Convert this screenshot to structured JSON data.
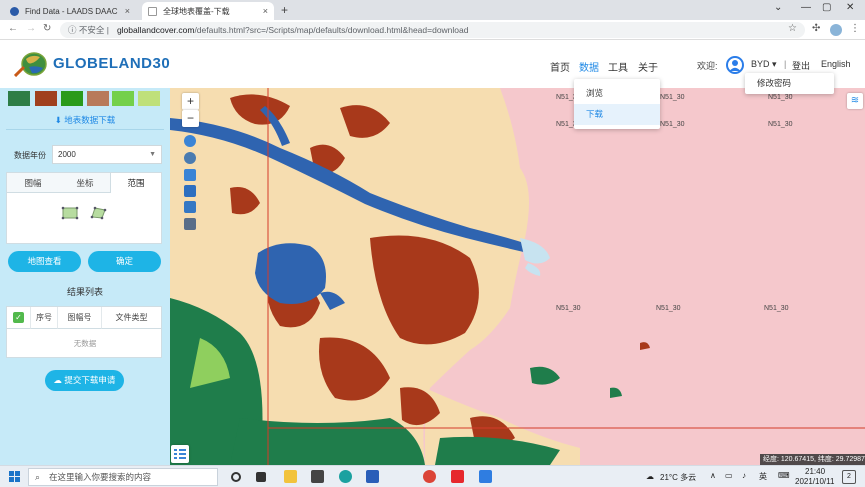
{
  "browser": {
    "tabs": [
      {
        "label": "Find Data - LAADS DAAC",
        "close": "×",
        "active": false
      },
      {
        "label": "全球地表覆盖-下载",
        "close": "×",
        "active": true
      }
    ],
    "new_tab": "+",
    "window_controls": [
      "⌄",
      "—",
      "▢",
      "✕"
    ],
    "insecure_label": "ⓘ 不安全 |",
    "url_host": "globallandcover.com",
    "url_path": "/defaults.html?src=/Scripts/map/defaults/download.html&head=download"
  },
  "header": {
    "logo": "GLOBELAND30",
    "nav": [
      "首页",
      "数据",
      "工具",
      "关于"
    ],
    "active_nav": "数据",
    "welcome": "欢迎:",
    "user": "BYD ▾",
    "divider": "|",
    "logout": "登出",
    "language": "English",
    "user_menu": [
      "修改密码"
    ],
    "data_menu": [
      {
        "label": "浏览",
        "selected": false
      },
      {
        "label": "下载",
        "selected": true
      }
    ]
  },
  "sidebar": {
    "swatch_colors": [
      "#2e7d46",
      "#a0401e",
      "#2a9a1a",
      "#b87a5a",
      "#74d04a",
      "#bfe07a"
    ],
    "download_title": "⬇ 地表数据下载",
    "year_label": "数据年份",
    "year_value": "2000",
    "subtabs": [
      "图幅",
      "坐标",
      "范围"
    ],
    "active_subtab": "范围",
    "btn_map_view": "地图查看",
    "btn_confirm": "确定",
    "results_title": "结果列表",
    "table_headers": [
      "序号",
      "图幅号",
      "文件类型"
    ],
    "no_data": "无数据",
    "submit_button": "提交下载申请"
  },
  "map": {
    "zoom_in": "+",
    "zoom_out": "−",
    "grid_labels": [
      "N51_30",
      "N51_30",
      "N51_30",
      "N51_30",
      "N51_30",
      "N51_30",
      "N51_30",
      "N51_30",
      "N51_30"
    ],
    "coords": "经度: 120.67415, 纬度: 29.72987",
    "colors": {
      "sea": "#f5c8cc",
      "cropland": "#f6ddb0",
      "artificial": "#a8391b",
      "water": "#2f64b0",
      "forest": "#1f7d4b",
      "grass": "#8fcf5e",
      "bare": "#c7e3f0",
      "frame": "#d43b2a"
    }
  },
  "taskbar": {
    "search_placeholder": "在这里输入你要搜索的内容",
    "weather": "21°C 多云",
    "time": "21:40",
    "date": "2021/10/11",
    "notification_count": "2",
    "apps": [
      "task-view",
      "widgets",
      "file-explorer",
      "store",
      "edge",
      "word",
      "chrome",
      "app-red",
      "app-blue"
    ]
  }
}
